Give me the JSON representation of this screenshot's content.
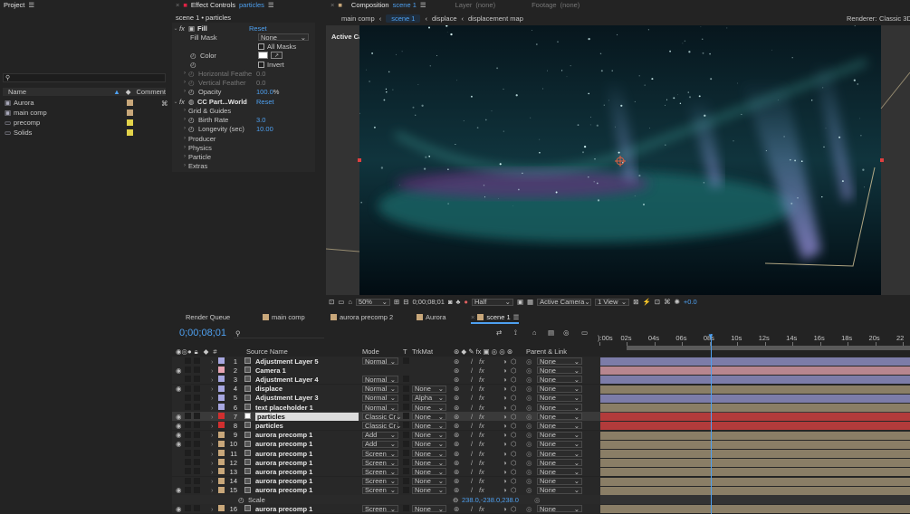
{
  "project": {
    "title": "Project",
    "search_placeholder": "",
    "col_name": "Name",
    "col_comment": "Comment",
    "items": [
      {
        "name": "Aurora",
        "kind": "comp",
        "color": "#c8a77a"
      },
      {
        "name": "main comp",
        "kind": "comp",
        "color": "#c8a77a"
      },
      {
        "name": "precomp",
        "kind": "folder",
        "color": "#e3d34a"
      },
      {
        "name": "Solids",
        "kind": "folder",
        "color": "#e3d34a"
      }
    ]
  },
  "effect_controls": {
    "tab_label": "Effect Controls",
    "tab_layer": "particles",
    "breadcrumb": "scene 1 • particles",
    "fill": {
      "name": "Fill",
      "reset": "Reset",
      "fill_mask_label": "Fill Mask",
      "fill_mask_value": "None",
      "all_masks": "All Masks",
      "color_label": "Color",
      "invert": "Invert",
      "horizontal_feather": "Horizontal Feathe",
      "horizontal_feather_value": "0.0",
      "vertical_feather": "Vertical Feather",
      "vertical_feather_value": "0.0",
      "opacity_label": "Opacity",
      "opacity_value": "100.0",
      "opacity_unit": "%"
    },
    "cc": {
      "name": "CC Part...World",
      "reset": "Reset",
      "grid": "Grid & Guides",
      "birth_rate_label": "Birth Rate",
      "birth_rate_value": "3.0",
      "longevity_label": "Longevity (sec)",
      "longevity_value": "10.00",
      "producer": "Producer",
      "physics": "Physics",
      "particle": "Particle",
      "extras": "Extras"
    }
  },
  "composition": {
    "tab_label": "Composition",
    "tab_name": "scene 1",
    "layer_label": "Layer",
    "layer_value": "(none)",
    "footage_label": "Footage",
    "footage_value": "(none)",
    "breadcrumbs": [
      "main comp",
      "scene 1",
      "displace",
      "displacement map"
    ],
    "renderer_label": "Renderer:",
    "renderer_value": "Classic 3D",
    "active_camera": "Active Camera",
    "footer": {
      "zoom": "50%",
      "timecode": "0;00;08;01",
      "resolution": "Half",
      "camera": "Active Camera",
      "views": "1 View",
      "exposure": "+0.0"
    }
  },
  "timeline": {
    "tabs": [
      "Render Queue",
      "main comp",
      "aurora precomp 2",
      "Aurora",
      "scene 1"
    ],
    "active_tab": "scene 1",
    "timecode": "0;00;08;01",
    "search_placeholder": "",
    "col_source": "Source Name",
    "col_mode": "Mode",
    "col_t": "T",
    "col_trkmat": "TrkMat",
    "col_parent": "Parent & Link",
    "ruler": [
      "):00s",
      "02s",
      "04s",
      "06s",
      "08s",
      "10s",
      "12s",
      "14s",
      "16s",
      "18s",
      "20s",
      "22"
    ],
    "playhead_fraction": 0.367,
    "layers": [
      {
        "num": "1",
        "name": "Adjustment Layer 5",
        "label": "#a7a7e0",
        "mode": "Normal",
        "trkmat": "",
        "parent": "None",
        "bar": "#7c7ca8",
        "eye": false
      },
      {
        "num": "2",
        "name": "Camera 1",
        "label": "#e8a5b3",
        "mode": "",
        "trkmat": "",
        "parent": "None",
        "bar": "#b7868f",
        "eye": true
      },
      {
        "num": "3",
        "name": "Adjustment Layer 4",
        "label": "#a7a7e0",
        "mode": "Normal",
        "trkmat": "",
        "parent": "None",
        "bar": "#7c7ca8",
        "eye": false
      },
      {
        "num": "4",
        "name": "displace",
        "label": "#a7a7e0",
        "mode": "Normal",
        "trkmat": "None",
        "parent": "None",
        "bar": "#8a7e66",
        "eye": true
      },
      {
        "num": "5",
        "name": "Adjustment Layer 3",
        "label": "#a7a7e0",
        "mode": "Normal",
        "trkmat": "Alpha",
        "parent": "None",
        "bar": "#7c7ca8",
        "eye": false
      },
      {
        "num": "6",
        "name": "text placeholder 1",
        "label": "#a7a7e0",
        "mode": "Normal",
        "trkmat": "None",
        "parent": "None",
        "bar": "#8a7e66",
        "eye": false
      },
      {
        "num": "7",
        "name": "particles",
        "label": "#d12f2f",
        "mode": "Classic Cr",
        "trkmat": "None",
        "parent": "None",
        "bar": "#b23b3b",
        "eye": true,
        "selected": true
      },
      {
        "num": "8",
        "name": "particles",
        "label": "#d12f2f",
        "mode": "Classic Cr",
        "trkmat": "None",
        "parent": "None",
        "bar": "#b23b3b",
        "eye": true
      },
      {
        "num": "9",
        "name": "aurora precomp 1",
        "label": "#c8a77a",
        "mode": "Add",
        "trkmat": "None",
        "parent": "None",
        "bar": "#8a7e66",
        "eye": true
      },
      {
        "num": "10",
        "name": "aurora precomp 1",
        "label": "#c8a77a",
        "mode": "Add",
        "trkmat": "None",
        "parent": "None",
        "bar": "#8a7e66",
        "eye": true
      },
      {
        "num": "11",
        "name": "aurora precomp 1",
        "label": "#c8a77a",
        "mode": "Screen",
        "trkmat": "None",
        "parent": "None",
        "bar": "#8a7e66",
        "eye": false
      },
      {
        "num": "12",
        "name": "aurora precomp 1",
        "label": "#c8a77a",
        "mode": "Screen",
        "trkmat": "None",
        "parent": "None",
        "bar": "#8a7e66",
        "eye": false
      },
      {
        "num": "13",
        "name": "aurora precomp 1",
        "label": "#c8a77a",
        "mode": "Screen",
        "trkmat": "None",
        "parent": "None",
        "bar": "#8a7e66",
        "eye": false
      },
      {
        "num": "14",
        "name": "aurora precomp 1",
        "label": "#c8a77a",
        "mode": "Screen",
        "trkmat": "None",
        "parent": "None",
        "bar": "#8a7e66",
        "eye": false
      },
      {
        "num": "15",
        "name": "aurora precomp 1",
        "label": "#c8a77a",
        "mode": "Screen",
        "trkmat": "None",
        "parent": "None",
        "bar": "#8a7e66",
        "eye": true
      }
    ],
    "scale": {
      "label": "Scale",
      "value": "238.0,-238.0,238.0"
    },
    "last_layer": {
      "num": "16",
      "name": "aurora precomp 1",
      "label": "#c8a77a",
      "mode": "Screen",
      "trkmat": "None",
      "parent": "None",
      "bar": "#8a7e66",
      "eye": true
    }
  }
}
